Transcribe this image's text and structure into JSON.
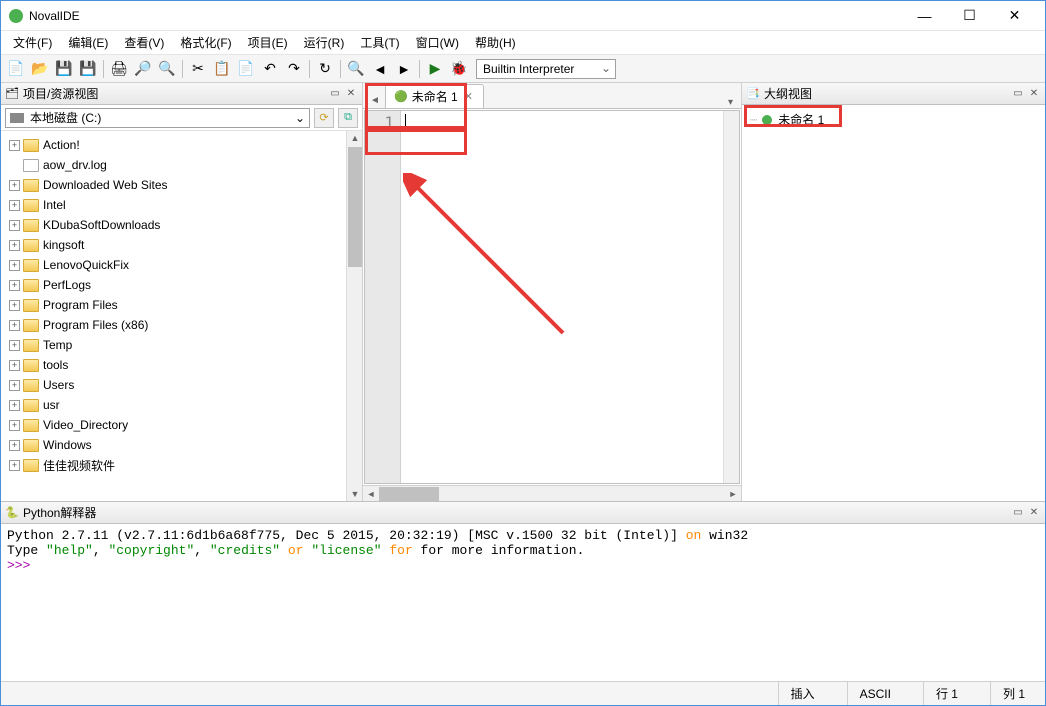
{
  "window": {
    "title": "NovalIDE"
  },
  "menu": [
    "文件(F)",
    "编辑(E)",
    "查看(V)",
    "格式化(F)",
    "项目(E)",
    "运行(R)",
    "工具(T)",
    "窗口(W)",
    "帮助(H)"
  ],
  "interpreter": "Builtin Interpreter",
  "panes": {
    "project": "项目/资源视图",
    "outline": "大纲视图",
    "console": "Python解释器"
  },
  "drive": "本地磁盘 (C:)",
  "tree": [
    {
      "label": "Action!",
      "exp": "+",
      "type": "folder"
    },
    {
      "label": "aow_drv.log",
      "exp": "",
      "type": "file"
    },
    {
      "label": "Downloaded Web Sites",
      "exp": "+",
      "type": "folder"
    },
    {
      "label": "Intel",
      "exp": "+",
      "type": "folder"
    },
    {
      "label": "KDubaSoftDownloads",
      "exp": "+",
      "type": "folder"
    },
    {
      "label": "kingsoft",
      "exp": "+",
      "type": "folder"
    },
    {
      "label": "LenovoQuickFix",
      "exp": "+",
      "type": "folder"
    },
    {
      "label": "PerfLogs",
      "exp": "+",
      "type": "folder"
    },
    {
      "label": "Program Files",
      "exp": "+",
      "type": "folder"
    },
    {
      "label": "Program Files (x86)",
      "exp": "+",
      "type": "folder"
    },
    {
      "label": "Temp",
      "exp": "+",
      "type": "folder"
    },
    {
      "label": "tools",
      "exp": "+",
      "type": "folder"
    },
    {
      "label": "Users",
      "exp": "+",
      "type": "folder"
    },
    {
      "label": "usr",
      "exp": "+",
      "type": "folder"
    },
    {
      "label": "Video_Directory",
      "exp": "+",
      "type": "folder"
    },
    {
      "label": "Windows",
      "exp": "+",
      "type": "folder"
    },
    {
      "label": "佳佳视频软件",
      "exp": "+",
      "type": "folder"
    }
  ],
  "tab": {
    "label": "未命名 1"
  },
  "editor": {
    "line": "1"
  },
  "outline_item": "未命名 1",
  "console_lines": {
    "l1a": "Python 2.7.11 (v2.7.11:6d1b6a68f775, Dec  5 2015, 20:32:19) [MSC v.1500 32 bit (Intel)] ",
    "l1b": "on",
    "l1c": " win32",
    "l2a": "Type ",
    "help": "\"help\"",
    "copyright": "\"copyright\"",
    "credits": "\"credits\"",
    "license": "\"license\"",
    "or": " or ",
    "comma": ", ",
    "l2b": " for more information.",
    "prompt": ">>>",
    "for_kw": "for"
  },
  "status": {
    "insert": "插入",
    "encoding": "ASCII",
    "line": "行 1",
    "col": "列 1"
  }
}
